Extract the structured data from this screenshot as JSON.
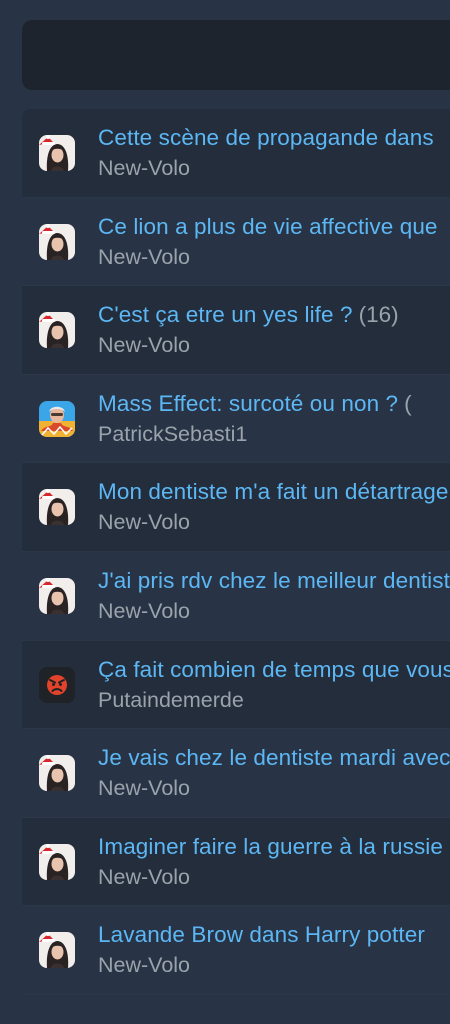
{
  "topics": [
    {
      "title": "Cette scène de propagande dans",
      "reply_count": "",
      "author": "New-Volo",
      "avatar": "santa-hat-avatar"
    },
    {
      "title": "Ce lion a plus de vie affective que",
      "reply_count": "",
      "author": "New-Volo",
      "avatar": "santa-hat-avatar"
    },
    {
      "title": "C'est ça etre un yes life ?",
      "reply_count": "(16)",
      "author": "New-Volo",
      "avatar": "santa-hat-avatar"
    },
    {
      "title": "Mass Effect: surcoté ou non ?",
      "reply_count": "(",
      "author": "PatrickSebasti1",
      "avatar": "sebastien-avatar"
    },
    {
      "title": "Mon dentiste m'a fait un détartrage",
      "reply_count": "",
      "author": "New-Volo",
      "avatar": "santa-hat-avatar"
    },
    {
      "title": "J'ai pris rdv chez le meilleur dentiste",
      "reply_count": "",
      "author": "New-Volo",
      "avatar": "santa-hat-avatar"
    },
    {
      "title": "Ça fait combien de temps que vous",
      "reply_count": "",
      "author": "Putaindemerde",
      "avatar": "angry-face-avatar"
    },
    {
      "title": "Je vais chez le dentiste mardi avec",
      "reply_count": "",
      "author": "New-Volo",
      "avatar": "santa-hat-avatar"
    },
    {
      "title": "Imaginer faire la guerre à la russie",
      "reply_count": "",
      "author": "New-Volo",
      "avatar": "santa-hat-avatar"
    },
    {
      "title": "Lavande Brow dans Harry potter",
      "reply_count": "",
      "author": "New-Volo",
      "avatar": "santa-hat-avatar"
    }
  ],
  "colors": {
    "background": "#283445",
    "row_alt": "#232d3b",
    "top_panel": "#1e242d",
    "title_link": "#5cb7f4",
    "muted_text": "#9aa2ab"
  }
}
